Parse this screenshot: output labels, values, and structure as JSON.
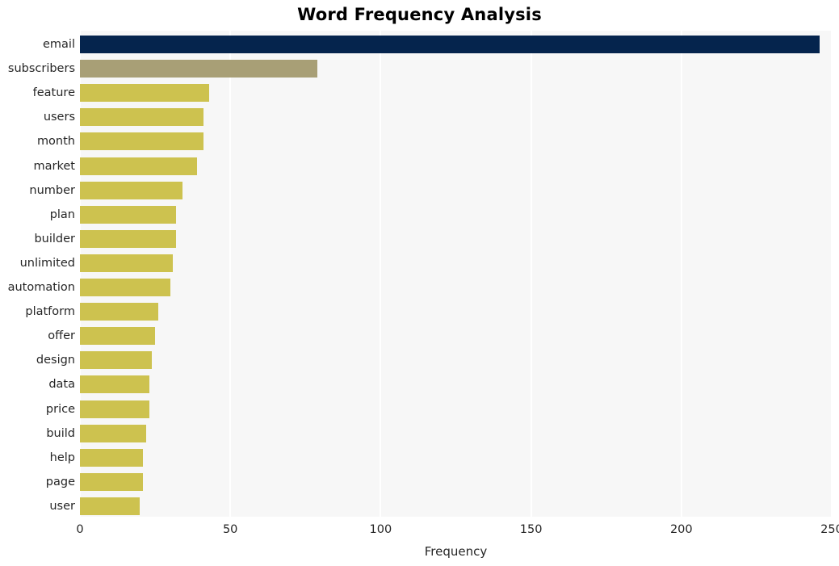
{
  "chart_data": {
    "type": "bar",
    "orientation": "horizontal",
    "title": "Word Frequency Analysis",
    "xlabel": "Frequency",
    "ylabel": "",
    "xlim": [
      0,
      250
    ],
    "xticks": [
      0,
      50,
      100,
      150,
      200,
      250
    ],
    "xticklabels": [
      "0",
      "50",
      "100",
      "150",
      "200",
      "250"
    ],
    "grid": true,
    "grid_axis": "x",
    "legend": null,
    "categories": [
      "email",
      "subscribers",
      "feature",
      "users",
      "month",
      "market",
      "number",
      "plan",
      "builder",
      "unlimited",
      "automation",
      "platform",
      "offer",
      "design",
      "data",
      "price",
      "build",
      "help",
      "page",
      "user"
    ],
    "values": [
      246,
      79,
      43,
      41,
      41,
      39,
      34,
      32,
      32,
      31,
      30,
      26,
      25,
      24,
      23,
      23,
      22,
      21,
      21,
      20
    ],
    "bar_colors": [
      "#05244d",
      "#a89f76",
      "#cdc24f",
      "#cdc24f",
      "#cdc24f",
      "#cdc24f",
      "#cdc24f",
      "#cdc24f",
      "#cdc24f",
      "#cdc24f",
      "#cdc24f",
      "#cdc24f",
      "#cdc24f",
      "#cdc24f",
      "#cdc24f",
      "#cdc24f",
      "#cdc24f",
      "#cdc24f",
      "#cdc24f",
      "#cdc24f"
    ],
    "plot_background": "#f7f7f7",
    "grid_color": "#ffffff",
    "figure_background": "#ffffff",
    "text_color": "#262626"
  }
}
